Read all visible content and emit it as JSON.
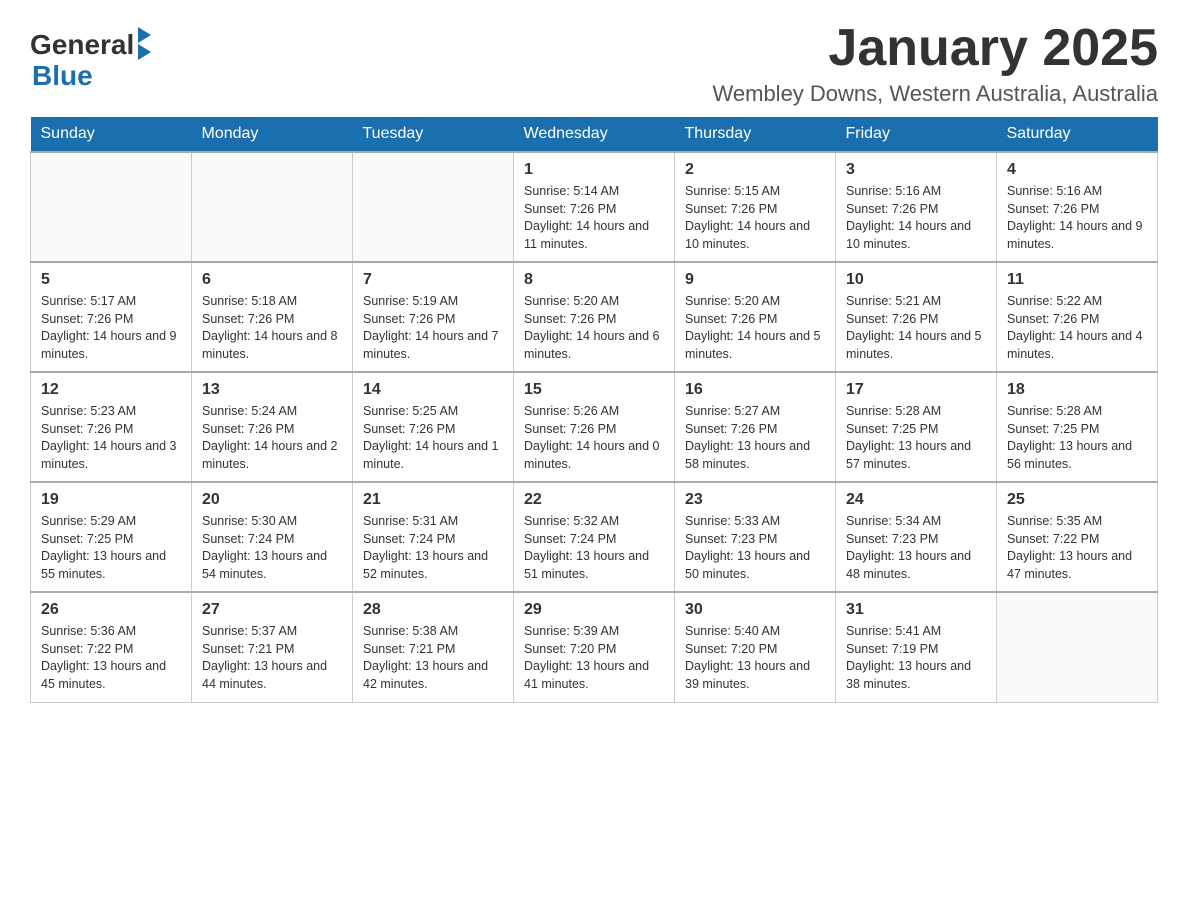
{
  "header": {
    "logo_general": "General",
    "logo_blue": "Blue",
    "month_title": "January 2025",
    "location": "Wembley Downs, Western Australia, Australia"
  },
  "days_of_week": [
    "Sunday",
    "Monday",
    "Tuesday",
    "Wednesday",
    "Thursday",
    "Friday",
    "Saturday"
  ],
  "weeks": [
    [
      {
        "day": "",
        "info": ""
      },
      {
        "day": "",
        "info": ""
      },
      {
        "day": "",
        "info": ""
      },
      {
        "day": "1",
        "info": "Sunrise: 5:14 AM\nSunset: 7:26 PM\nDaylight: 14 hours and 11 minutes."
      },
      {
        "day": "2",
        "info": "Sunrise: 5:15 AM\nSunset: 7:26 PM\nDaylight: 14 hours and 10 minutes."
      },
      {
        "day": "3",
        "info": "Sunrise: 5:16 AM\nSunset: 7:26 PM\nDaylight: 14 hours and 10 minutes."
      },
      {
        "day": "4",
        "info": "Sunrise: 5:16 AM\nSunset: 7:26 PM\nDaylight: 14 hours and 9 minutes."
      }
    ],
    [
      {
        "day": "5",
        "info": "Sunrise: 5:17 AM\nSunset: 7:26 PM\nDaylight: 14 hours and 9 minutes."
      },
      {
        "day": "6",
        "info": "Sunrise: 5:18 AM\nSunset: 7:26 PM\nDaylight: 14 hours and 8 minutes."
      },
      {
        "day": "7",
        "info": "Sunrise: 5:19 AM\nSunset: 7:26 PM\nDaylight: 14 hours and 7 minutes."
      },
      {
        "day": "8",
        "info": "Sunrise: 5:20 AM\nSunset: 7:26 PM\nDaylight: 14 hours and 6 minutes."
      },
      {
        "day": "9",
        "info": "Sunrise: 5:20 AM\nSunset: 7:26 PM\nDaylight: 14 hours and 5 minutes."
      },
      {
        "day": "10",
        "info": "Sunrise: 5:21 AM\nSunset: 7:26 PM\nDaylight: 14 hours and 5 minutes."
      },
      {
        "day": "11",
        "info": "Sunrise: 5:22 AM\nSunset: 7:26 PM\nDaylight: 14 hours and 4 minutes."
      }
    ],
    [
      {
        "day": "12",
        "info": "Sunrise: 5:23 AM\nSunset: 7:26 PM\nDaylight: 14 hours and 3 minutes."
      },
      {
        "day": "13",
        "info": "Sunrise: 5:24 AM\nSunset: 7:26 PM\nDaylight: 14 hours and 2 minutes."
      },
      {
        "day": "14",
        "info": "Sunrise: 5:25 AM\nSunset: 7:26 PM\nDaylight: 14 hours and 1 minute."
      },
      {
        "day": "15",
        "info": "Sunrise: 5:26 AM\nSunset: 7:26 PM\nDaylight: 14 hours and 0 minutes."
      },
      {
        "day": "16",
        "info": "Sunrise: 5:27 AM\nSunset: 7:26 PM\nDaylight: 13 hours and 58 minutes."
      },
      {
        "day": "17",
        "info": "Sunrise: 5:28 AM\nSunset: 7:25 PM\nDaylight: 13 hours and 57 minutes."
      },
      {
        "day": "18",
        "info": "Sunrise: 5:28 AM\nSunset: 7:25 PM\nDaylight: 13 hours and 56 minutes."
      }
    ],
    [
      {
        "day": "19",
        "info": "Sunrise: 5:29 AM\nSunset: 7:25 PM\nDaylight: 13 hours and 55 minutes."
      },
      {
        "day": "20",
        "info": "Sunrise: 5:30 AM\nSunset: 7:24 PM\nDaylight: 13 hours and 54 minutes."
      },
      {
        "day": "21",
        "info": "Sunrise: 5:31 AM\nSunset: 7:24 PM\nDaylight: 13 hours and 52 minutes."
      },
      {
        "day": "22",
        "info": "Sunrise: 5:32 AM\nSunset: 7:24 PM\nDaylight: 13 hours and 51 minutes."
      },
      {
        "day": "23",
        "info": "Sunrise: 5:33 AM\nSunset: 7:23 PM\nDaylight: 13 hours and 50 minutes."
      },
      {
        "day": "24",
        "info": "Sunrise: 5:34 AM\nSunset: 7:23 PM\nDaylight: 13 hours and 48 minutes."
      },
      {
        "day": "25",
        "info": "Sunrise: 5:35 AM\nSunset: 7:22 PM\nDaylight: 13 hours and 47 minutes."
      }
    ],
    [
      {
        "day": "26",
        "info": "Sunrise: 5:36 AM\nSunset: 7:22 PM\nDaylight: 13 hours and 45 minutes."
      },
      {
        "day": "27",
        "info": "Sunrise: 5:37 AM\nSunset: 7:21 PM\nDaylight: 13 hours and 44 minutes."
      },
      {
        "day": "28",
        "info": "Sunrise: 5:38 AM\nSunset: 7:21 PM\nDaylight: 13 hours and 42 minutes."
      },
      {
        "day": "29",
        "info": "Sunrise: 5:39 AM\nSunset: 7:20 PM\nDaylight: 13 hours and 41 minutes."
      },
      {
        "day": "30",
        "info": "Sunrise: 5:40 AM\nSunset: 7:20 PM\nDaylight: 13 hours and 39 minutes."
      },
      {
        "day": "31",
        "info": "Sunrise: 5:41 AM\nSunset: 7:19 PM\nDaylight: 13 hours and 38 minutes."
      },
      {
        "day": "",
        "info": ""
      }
    ]
  ]
}
